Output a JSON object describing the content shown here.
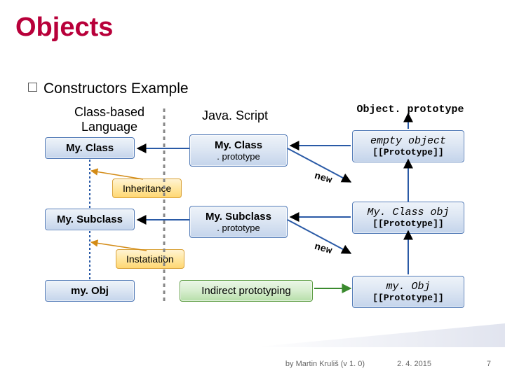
{
  "title": "Objects",
  "subtitle": "Constructors Example",
  "columns": {
    "left_heading": "Class-based Language",
    "mid_heading": "Java. Script",
    "right_heading": "Object. prototype"
  },
  "left": {
    "myclass": "My. Class",
    "mysubclass": "My. Subclass",
    "myobj": "my. Obj"
  },
  "mid": {
    "myclass_proto_l1": "My. Class",
    "myclass_proto_l2": ". prototype",
    "mysub_proto_l1": "My. Subclass",
    "mysub_proto_l2": ". prototype",
    "indirect": "Indirect prototyping"
  },
  "right": {
    "empty_l1": "empty object",
    "empty_l2": "[[Prototype]]",
    "classobj_l1": "My. Class obj",
    "classobj_l2": "[[Prototype]]",
    "instobj_l1": "my. Obj",
    "instobj_l2": "[[Prototype]]"
  },
  "tags": {
    "inheritance": "Inheritance",
    "instantiation": "Instatiation"
  },
  "labels": {
    "new": "new"
  },
  "footer": {
    "author": "by Martin Kruliš (v 1. 0)",
    "date": "2. 4. 2015",
    "page": "7"
  }
}
